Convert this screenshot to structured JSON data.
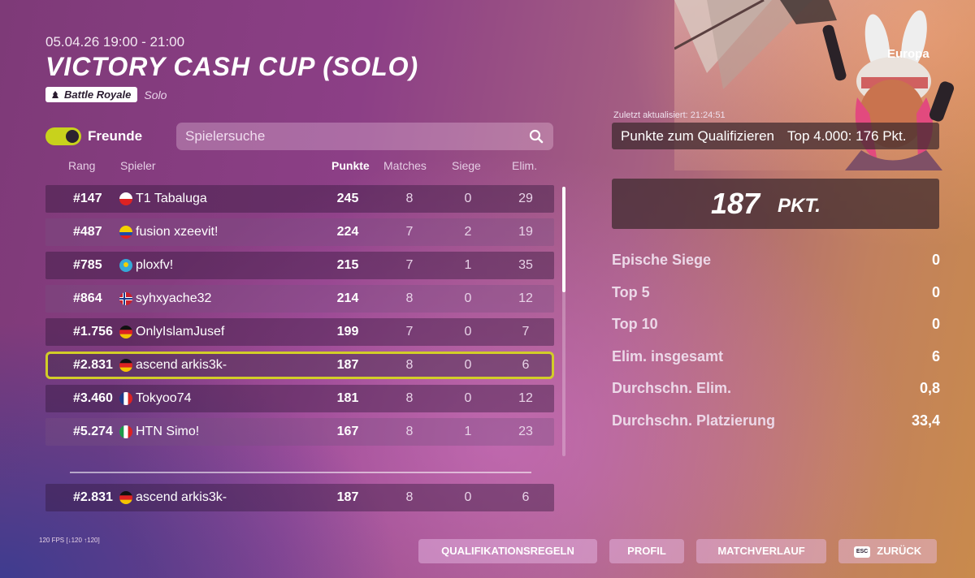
{
  "event": {
    "date_time": "05.04.26 19:00 - 21:00",
    "title": "VICTORY CASH CUP (SOLO)",
    "mode_tag": "Battle Royale",
    "mode_sub": "Solo"
  },
  "filters": {
    "friends_label": "Freunde",
    "friends_toggle_on": true,
    "search_placeholder": "Spielersuche"
  },
  "table": {
    "headers": {
      "rank": "Rang",
      "player": "Spieler",
      "points": "Punkte",
      "matches": "Matches",
      "wins": "Siege",
      "elims": "Elim."
    },
    "rows": [
      {
        "rank": "#147",
        "flag": "PL",
        "player": "T1 Tabaluga",
        "points": "245",
        "matches": "8",
        "wins": "0",
        "elims": "29"
      },
      {
        "rank": "#487",
        "flag": "CO",
        "player": "fusion xzeevit!",
        "points": "224",
        "matches": "7",
        "wins": "2",
        "elims": "19"
      },
      {
        "rank": "#785",
        "flag": "KZ",
        "player": "ploxfv!",
        "points": "215",
        "matches": "7",
        "wins": "1",
        "elims": "35"
      },
      {
        "rank": "#864",
        "flag": "NO",
        "player": "syhxyache32",
        "points": "214",
        "matches": "8",
        "wins": "0",
        "elims": "12"
      },
      {
        "rank": "#1.756",
        "flag": "DE",
        "player": "OnlyIslamJusef",
        "points": "199",
        "matches": "7",
        "wins": "0",
        "elims": "7"
      },
      {
        "rank": "#2.831",
        "flag": "DE",
        "player": "ascend arkis3k-",
        "points": "187",
        "matches": "8",
        "wins": "0",
        "elims": "6",
        "current": true
      },
      {
        "rank": "#3.460",
        "flag": "FR",
        "player": "Tokyoo74",
        "points": "181",
        "matches": "8",
        "wins": "0",
        "elims": "12"
      },
      {
        "rank": "#5.274",
        "flag": "IT",
        "player": "HTN Simo!",
        "points": "167",
        "matches": "8",
        "wins": "1",
        "elims": "23"
      }
    ],
    "pinned_row": {
      "rank": "#2.831",
      "flag": "DE",
      "player": "ascend arkis3k-",
      "points": "187",
      "matches": "8",
      "wins": "0",
      "elims": "6"
    }
  },
  "side": {
    "region": "Europa",
    "updated": "Zuletzt aktualisiert: 21:24:51",
    "qualify_label": "Punkte zum Qualifizieren",
    "qualify_value": "Top 4.000: 176 Pkt.",
    "score_value": "187",
    "score_unit": "PKT.",
    "stats": [
      {
        "label": "Epische Siege",
        "value": "0"
      },
      {
        "label": "Top 5",
        "value": "0"
      },
      {
        "label": "Top 10",
        "value": "0"
      },
      {
        "label": "Elim. insgesamt",
        "value": "6"
      },
      {
        "label": "Durchschn. Elim.",
        "value": "0,8"
      },
      {
        "label": "Durchschn. Platzierung",
        "value": "33,4"
      }
    ]
  },
  "footer": {
    "fps": "120 FPS [↓120 ↑120]",
    "buttons": {
      "rules": "QUALIFIKATIONSREGELN",
      "profile": "PROFIL",
      "history": "MATCHVERLAUF",
      "back_key": "ESC",
      "back": "ZURÜCK"
    }
  },
  "colors": {
    "accent_yellow": "#d2cd28",
    "panel_dark": "#3c282d",
    "row_dark": "#32193c"
  }
}
